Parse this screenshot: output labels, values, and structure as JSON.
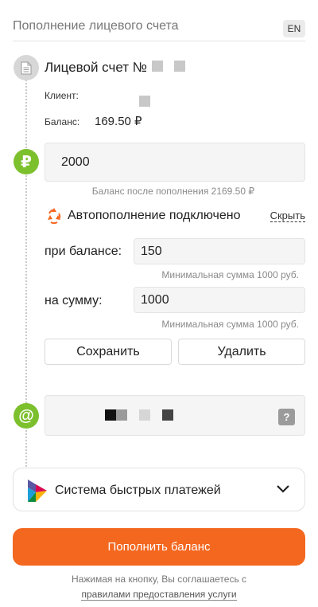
{
  "header": {
    "title": "Пополнение лицевого счета",
    "lang": "EN"
  },
  "account": {
    "title": "Лицевой счет №",
    "client_label": "Клиент:",
    "balance_label": "Баланс:",
    "balance_value": "169.50 ₽"
  },
  "payment": {
    "currency_symbol": "₽",
    "amount": "2000",
    "after_balance": "Баланс после пополнения 2169.50 ₽"
  },
  "autopay": {
    "title": "Автопополнение подключено",
    "hide_link": "Скрыть",
    "threshold_label": "при балансе:",
    "threshold_value": "150",
    "threshold_note": "Минимальная сумма 1000 руб.",
    "amount_label": "на сумму:",
    "amount_value": "1000",
    "amount_note": "Минимальная сумма 1000 руб.",
    "save_label": "Сохранить",
    "delete_label": "Удалить"
  },
  "email": {
    "at_symbol": "@",
    "help": "?"
  },
  "sbp": {
    "title": "Система быстрых платежей"
  },
  "submit": {
    "label": "Пополнить баланс"
  },
  "terms": {
    "line1": "Нажимая на кнопку, Вы соглашаетесь с",
    "link": "правилами предоставления услуги"
  },
  "colors": {
    "accent": "#f4671f",
    "step_green": "#7cc02d"
  }
}
